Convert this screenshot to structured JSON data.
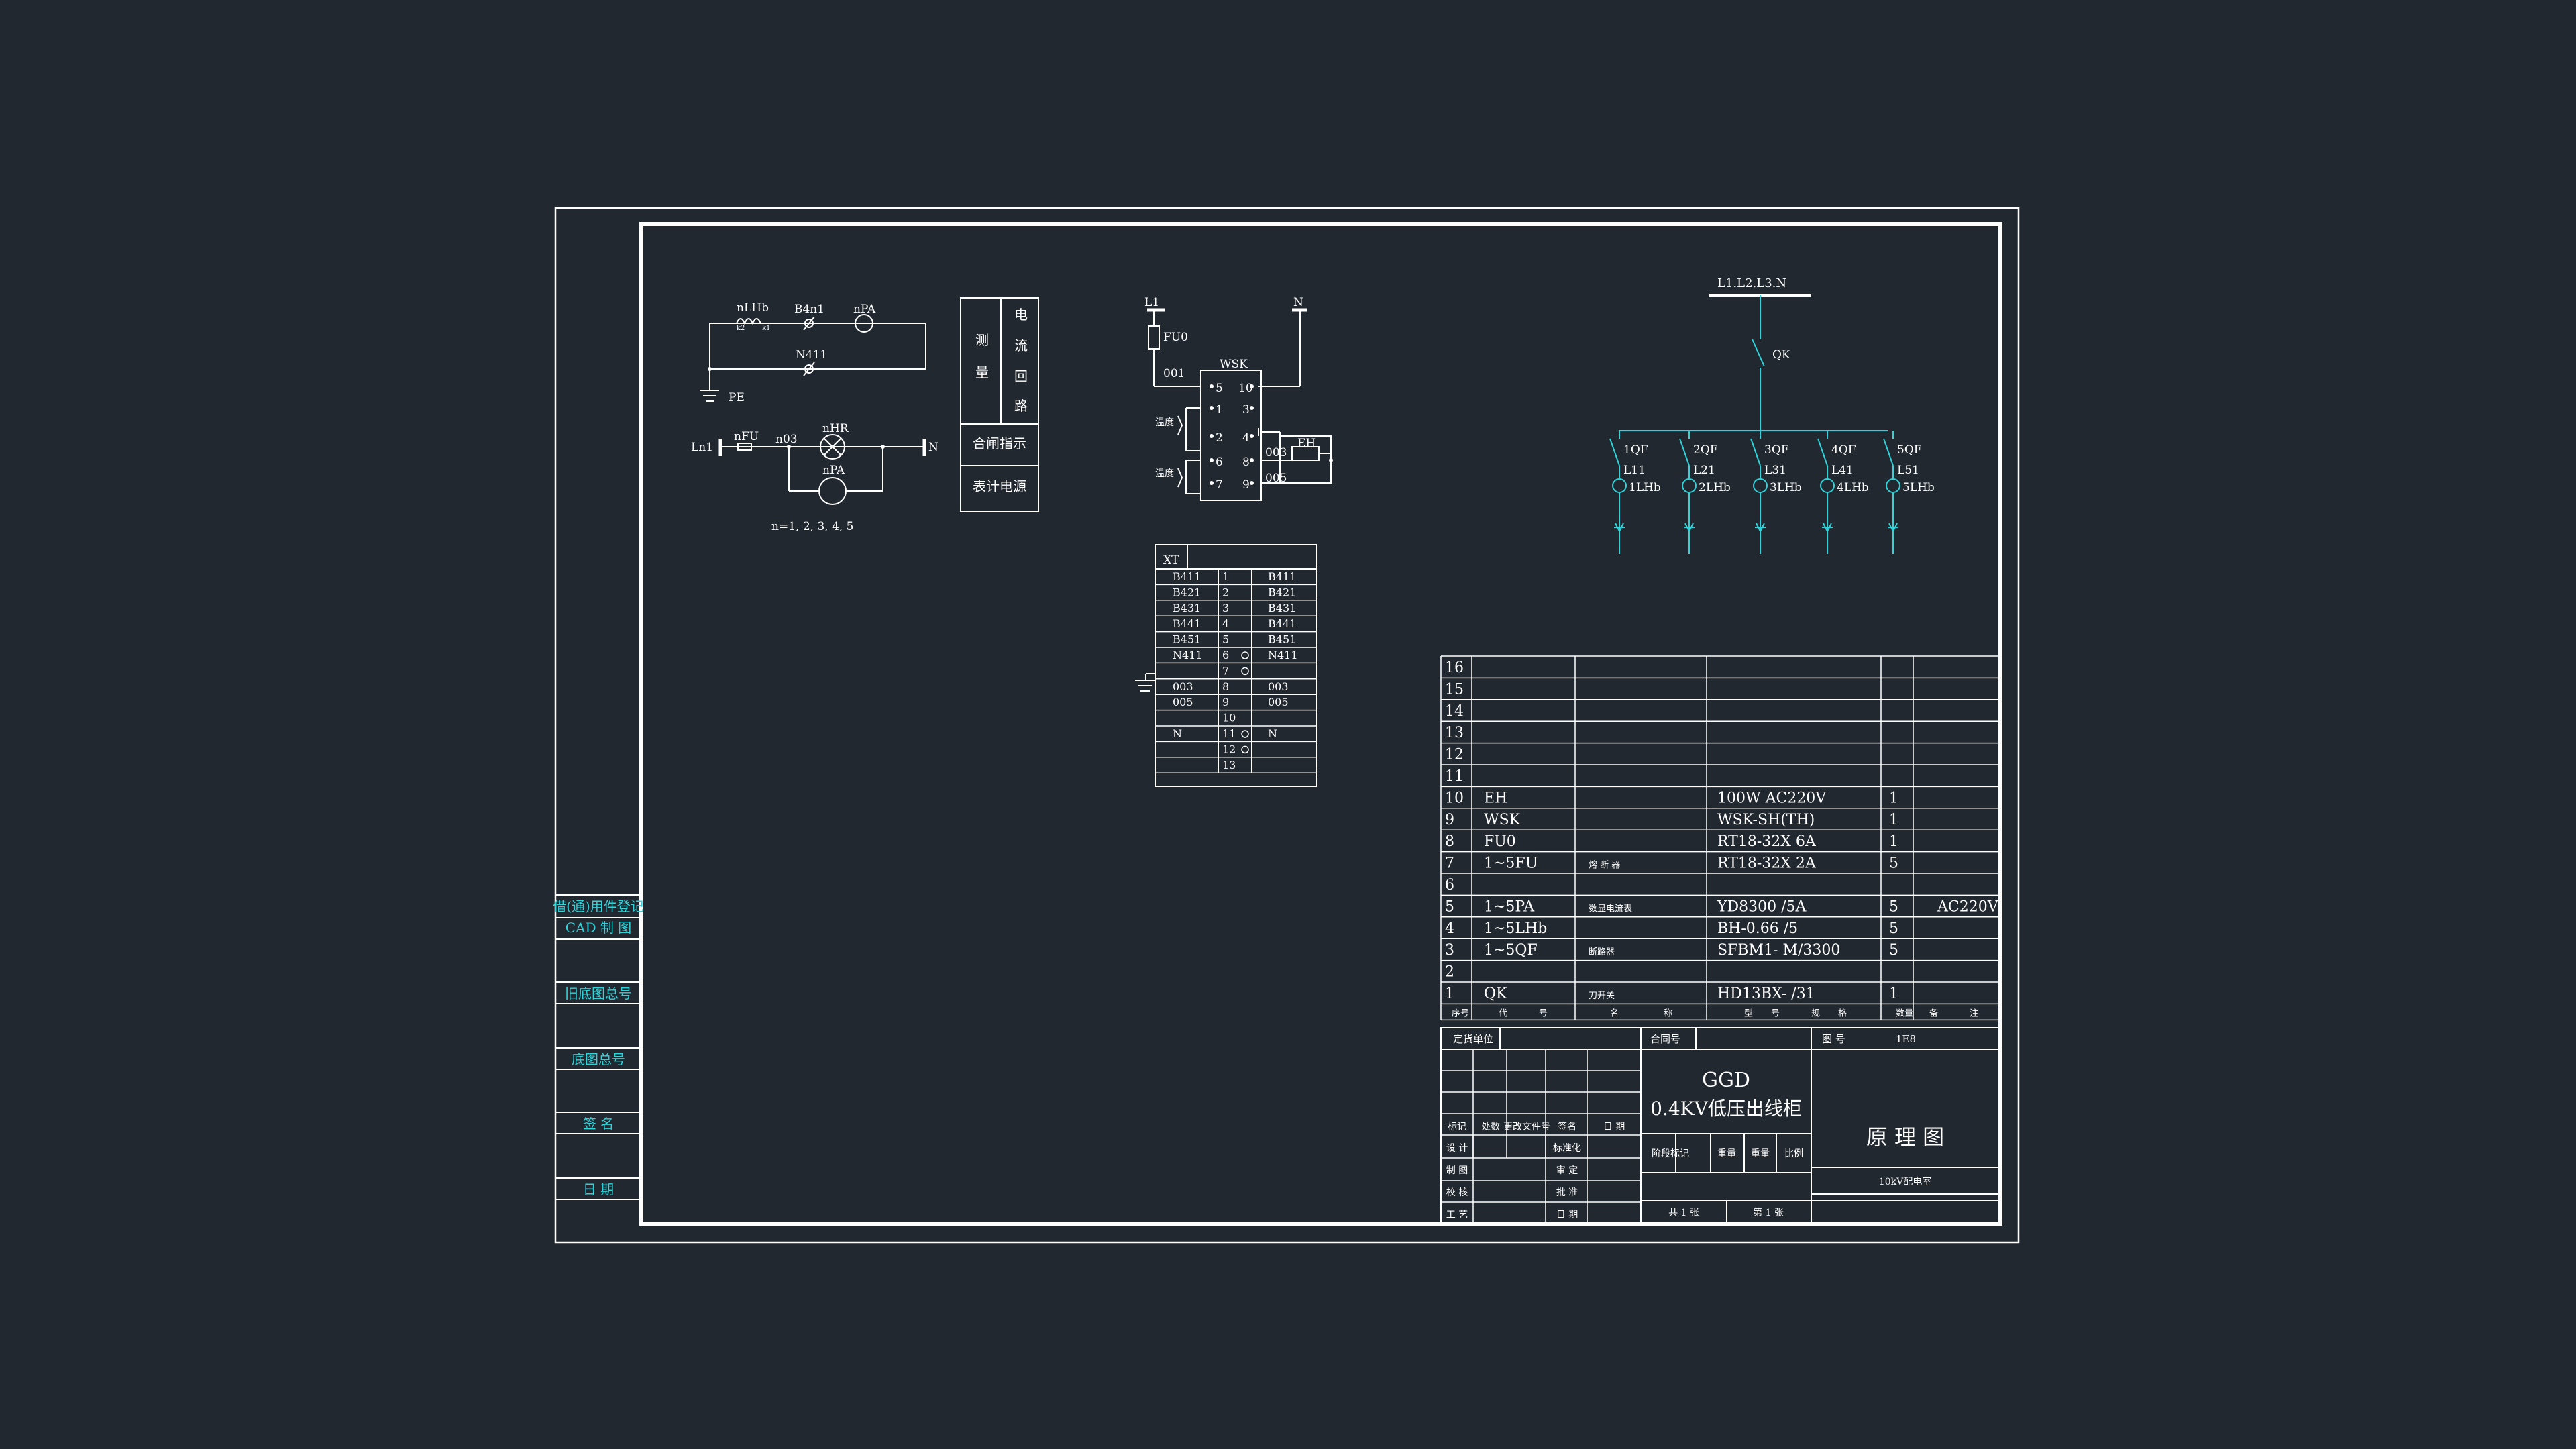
{
  "colors": {
    "background": "#212830",
    "line": "#ffffff",
    "accent": "#2fd3da"
  },
  "side_strip": [
    "借(通)用件登记",
    "CAD 制 图",
    "旧底图总号",
    "底图总号",
    "签 名",
    "日 期"
  ],
  "circuit_left": {
    "labels": [
      "nLHb",
      "B4n1",
      "nPA",
      "N411",
      "PE",
      "Ln1",
      "nFU",
      "n03",
      "nHR",
      "nPA",
      "N",
      "n=1, 2, 3, 4, 5"
    ],
    "small": [
      "k2",
      "k1"
    ]
  },
  "function_table": {
    "col1": [
      "测",
      "量"
    ],
    "col2": [
      "电",
      "流",
      "回",
      "路"
    ],
    "row2": "合闸指示",
    "row3": "表计电源"
  },
  "wsk_circuit": {
    "labels": [
      "L1",
      "N",
      "FU0",
      "WSK",
      "001",
      "003",
      "005",
      "EH",
      "温度",
      "温度"
    ],
    "left_terminals": [
      "5",
      "1",
      "2",
      "6",
      "7"
    ],
    "right_terminals": [
      "10",
      "3",
      "4",
      "8",
      "9"
    ]
  },
  "xt_table": {
    "title": "XT",
    "rows": [
      [
        "B411",
        "1",
        "B411"
      ],
      [
        "B421",
        "2",
        "B421"
      ],
      [
        "B431",
        "3",
        "B431"
      ],
      [
        "B441",
        "4",
        "B441"
      ],
      [
        "B451",
        "5",
        "B451"
      ],
      [
        "N411",
        "6",
        "N411"
      ],
      [
        "",
        "7",
        ""
      ],
      [
        "003",
        "8",
        "003"
      ],
      [
        "005",
        "9",
        "005"
      ],
      [
        "",
        "10",
        ""
      ],
      [
        "N",
        "11",
        "N"
      ],
      [
        "",
        "12",
        ""
      ],
      [
        "",
        "13",
        ""
      ]
    ]
  },
  "one_line": {
    "bus": "L1.L2.L3.N",
    "switch": "QK",
    "feeders": [
      {
        "qf": "1QF",
        "line": "L11",
        "lhb": "1LHb"
      },
      {
        "qf": "2QF",
        "line": "L21",
        "lhb": "2LHb"
      },
      {
        "qf": "3QF",
        "line": "L31",
        "lhb": "3LHb"
      },
      {
        "qf": "4QF",
        "line": "L41",
        "lhb": "4LHb"
      },
      {
        "qf": "5QF",
        "line": "L51",
        "lhb": "5LHb"
      }
    ]
  },
  "parts_list": {
    "rows": [
      {
        "no": "16",
        "code": "",
        "name": "",
        "model": "",
        "qty": "",
        "note": ""
      },
      {
        "no": "15",
        "code": "",
        "name": "",
        "model": "",
        "qty": "",
        "note": ""
      },
      {
        "no": "14",
        "code": "",
        "name": "",
        "model": "",
        "qty": "",
        "note": ""
      },
      {
        "no": "13",
        "code": "",
        "name": "",
        "model": "",
        "qty": "",
        "note": ""
      },
      {
        "no": "12",
        "code": "",
        "name": "",
        "model": "",
        "qty": "",
        "note": ""
      },
      {
        "no": "11",
        "code": "",
        "name": "",
        "model": "",
        "qty": "",
        "note": ""
      },
      {
        "no": "10",
        "code": "EH",
        "name": "",
        "model": "100W  AC220V",
        "qty": "1",
        "note": ""
      },
      {
        "no": "9",
        "code": "WSK",
        "name": "",
        "model": "WSK-SH(TH)",
        "qty": "1",
        "note": ""
      },
      {
        "no": "8",
        "code": "FU0",
        "name": "",
        "model": "RT18-32X   6A",
        "qty": "1",
        "note": ""
      },
      {
        "no": "7",
        "code": "1~5FU",
        "name": "熔 断 器",
        "model": "RT18-32X   2A",
        "qty": "5",
        "note": ""
      },
      {
        "no": "6",
        "code": "",
        "name": "",
        "model": "",
        "qty": "",
        "note": ""
      },
      {
        "no": "5",
        "code": "1~5PA",
        "name": "数显电流表",
        "model": "YD8300    /5A",
        "qty": "5",
        "note": "AC220V"
      },
      {
        "no": "4",
        "code": "1~5LHb",
        "name": "",
        "model": "BH-0.66    /5",
        "qty": "5",
        "note": ""
      },
      {
        "no": "3",
        "code": "1~5QF",
        "name": "断路器",
        "model": "SFBM1-  M/3300",
        "qty": "5",
        "note": ""
      },
      {
        "no": "2",
        "code": "",
        "name": "",
        "model": "",
        "qty": "",
        "note": ""
      },
      {
        "no": "1",
        "code": "QK",
        "name": "刀开关",
        "model": "HD13BX-      /31",
        "qty": "1",
        "note": ""
      }
    ],
    "header": [
      "序号",
      "代",
      "号",
      "名",
      "称",
      "型",
      "号",
      "规",
      "格",
      "数量",
      "备",
      "注"
    ]
  },
  "title_block": {
    "unit_label": "定货单位",
    "contract_label": "合同号",
    "drawing_no_label": "图 号",
    "drawing_no_value": "1E8",
    "product_code": "GGD",
    "product_name": "0.4KV低压出线柜",
    "drawing_title": "原 理 图",
    "revision_labels": [
      "标记",
      "处数",
      "更改文件号",
      "签名",
      "日 期"
    ],
    "sign_left": [
      "设 计",
      "制 图",
      "校 核",
      "工 艺"
    ],
    "sign_right": [
      "标准化",
      "审 定",
      "批 准",
      "日 期"
    ],
    "stage_labels": [
      "阶段标记",
      "重量",
      "重量",
      "比例"
    ],
    "total_sheets": "共 1 张",
    "sheet_no": "第 1 张",
    "company": "10kV配电室"
  }
}
